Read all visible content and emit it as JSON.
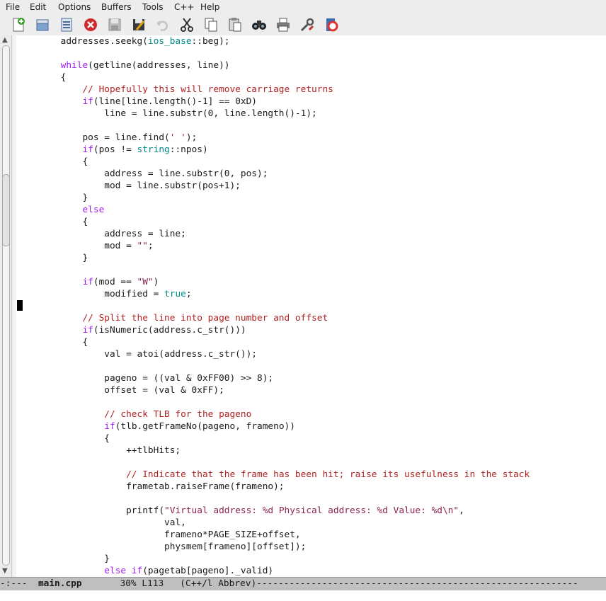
{
  "menu": [
    "File",
    "Edit",
    "Options",
    "Buffers",
    "Tools",
    "C++",
    "Help"
  ],
  "toolbar": [
    {
      "name": "new-file-icon"
    },
    {
      "name": "open-file-icon"
    },
    {
      "name": "open-directory-icon"
    },
    {
      "name": "close-buffer-icon"
    },
    {
      "name": "save-icon"
    },
    {
      "name": "save-as-icon"
    },
    {
      "name": "undo-icon"
    },
    {
      "name": "cut-icon"
    },
    {
      "name": "copy-icon"
    },
    {
      "name": "paste-icon"
    },
    {
      "name": "search-icon"
    },
    {
      "name": "print-icon"
    },
    {
      "name": "preferences-icon"
    },
    {
      "name": "help-icon"
    }
  ],
  "code_lines": [
    [
      [
        "n",
        "        addresses.seekg("
      ],
      [
        "t",
        "ios_base"
      ],
      [
        "n",
        "::beg);"
      ]
    ],
    [
      [
        "n",
        ""
      ]
    ],
    [
      [
        "n",
        "        "
      ],
      [
        "k",
        "while"
      ],
      [
        "n",
        "(getline(addresses, line))"
      ]
    ],
    [
      [
        "n",
        "        {"
      ]
    ],
    [
      [
        "n",
        "            "
      ],
      [
        "c",
        "// Hopefully this will remove carriage returns"
      ]
    ],
    [
      [
        "n",
        "            "
      ],
      [
        "k",
        "if"
      ],
      [
        "n",
        "(line[line.length()-1] == 0xD)"
      ]
    ],
    [
      [
        "n",
        "                line = line.substr(0, line.length()-1);"
      ]
    ],
    [
      [
        "n",
        ""
      ]
    ],
    [
      [
        "n",
        "            pos = line.find("
      ],
      [
        "s",
        "' '"
      ],
      [
        "n",
        ");"
      ]
    ],
    [
      [
        "n",
        "            "
      ],
      [
        "k",
        "if"
      ],
      [
        "n",
        "(pos != "
      ],
      [
        "t",
        "string"
      ],
      [
        "n",
        "::npos)"
      ]
    ],
    [
      [
        "n",
        "            {"
      ]
    ],
    [
      [
        "n",
        "                address = line.substr(0, pos);"
      ]
    ],
    [
      [
        "n",
        "                mod = line.substr(pos+1);"
      ]
    ],
    [
      [
        "n",
        "            }"
      ]
    ],
    [
      [
        "n",
        "            "
      ],
      [
        "k",
        "else"
      ]
    ],
    [
      [
        "n",
        "            {"
      ]
    ],
    [
      [
        "n",
        "                address = line;"
      ]
    ],
    [
      [
        "n",
        "                mod = "
      ],
      [
        "s",
        "\"\""
      ],
      [
        "n",
        ";"
      ]
    ],
    [
      [
        "n",
        "            }"
      ]
    ],
    [
      [
        "n",
        ""
      ]
    ],
    [
      [
        "n",
        "            "
      ],
      [
        "k",
        "if"
      ],
      [
        "n",
        "(mod == "
      ],
      [
        "s",
        "\"W\""
      ],
      [
        "n",
        ")"
      ]
    ],
    [
      [
        "n",
        "                modified = "
      ],
      [
        "t",
        "true"
      ],
      [
        "n",
        ";"
      ]
    ],
    [
      [
        "n",
        ""
      ]
    ],
    [
      [
        "n",
        "            "
      ],
      [
        "c",
        "// Split the line into page number and offset"
      ]
    ],
    [
      [
        "n",
        "            "
      ],
      [
        "k",
        "if"
      ],
      [
        "n",
        "(isNumeric(address.c_str()))"
      ]
    ],
    [
      [
        "n",
        "            {"
      ]
    ],
    [
      [
        "n",
        "                val = atoi(address.c_str());"
      ]
    ],
    [
      [
        "n",
        ""
      ]
    ],
    [
      [
        "n",
        "                pageno = ((val & 0xFF00) >> 8);"
      ]
    ],
    [
      [
        "n",
        "                offset = (val & 0xFF);"
      ]
    ],
    [
      [
        "n",
        ""
      ]
    ],
    [
      [
        "n",
        "                "
      ],
      [
        "c",
        "// check TLB for the pageno"
      ]
    ],
    [
      [
        "n",
        "                "
      ],
      [
        "k",
        "if"
      ],
      [
        "n",
        "(tlb.getFrameNo(pageno, frameno))"
      ]
    ],
    [
      [
        "n",
        "                {"
      ]
    ],
    [
      [
        "n",
        "                    ++tlbHits;"
      ]
    ],
    [
      [
        "n",
        ""
      ]
    ],
    [
      [
        "n",
        "                    "
      ],
      [
        "c",
        "// Indicate that the frame has been hit; raise its usefulness in the stack"
      ]
    ],
    [
      [
        "n",
        "                    frametab.raiseFrame(frameno);"
      ]
    ],
    [
      [
        "n",
        ""
      ]
    ],
    [
      [
        "n",
        "                    printf("
      ],
      [
        "s",
        "\"Virtual address: %d Physical address: %d Value: %d\\n\""
      ],
      [
        "n",
        ","
      ]
    ],
    [
      [
        "n",
        "                           val,"
      ]
    ],
    [
      [
        "n",
        "                           frameno*PAGE_SIZE+offset,"
      ]
    ],
    [
      [
        "n",
        "                           physmem[frameno][offset]);"
      ]
    ],
    [
      [
        "n",
        "                }"
      ]
    ],
    [
      [
        "n",
        "                "
      ],
      [
        "k",
        "else if"
      ],
      [
        "n",
        "(pagetab[pageno]._valid)"
      ]
    ]
  ],
  "modeline": {
    "prefix": "-:---  ",
    "buffer": "main.cpp",
    "position": "30% L113",
    "mode": "(C++/l Abbrev)",
    "fill": "-----------------------------------------------------------"
  }
}
